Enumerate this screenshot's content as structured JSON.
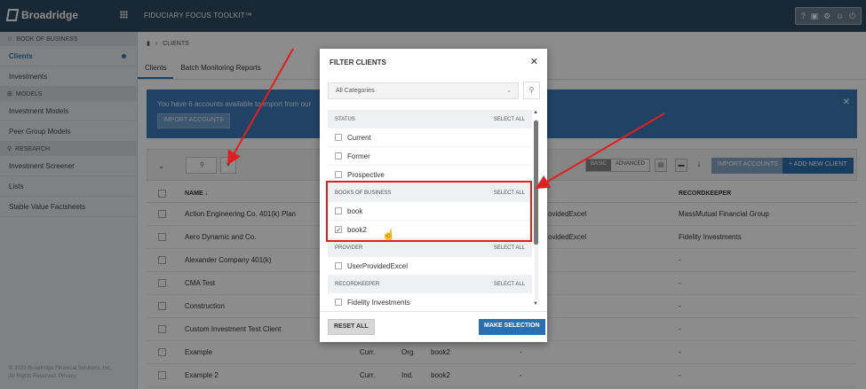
{
  "topbar": {
    "brand": "Broadridge",
    "app_title": "FIDUCIARY FOCUS TOOLKIT™",
    "icons": [
      "help-icon",
      "briefcase-icon",
      "gear-icon",
      "user-icon",
      "power-icon"
    ]
  },
  "sidebar": {
    "sections": [
      {
        "label": "BOOK OF BUSINESS",
        "items": [
          "Clients",
          "Investments"
        ]
      },
      {
        "label": "MODELS",
        "items": [
          "Investment Models",
          "Peer Group Models"
        ]
      },
      {
        "label": "RESEARCH",
        "items": [
          "Investment Screener",
          "Lists",
          "Stable Value Factsheets"
        ]
      }
    ],
    "copyright_1": "© 2023 Broadridge Financial Solutions, Inc.",
    "copyright_2": "All Rights Reserved. Privacy"
  },
  "breadcrumb": {
    "label": "CLIENTS"
  },
  "tabs": [
    "Clients",
    "Batch Monitoring Reports"
  ],
  "banner": {
    "text": "You have 6 accounts available to import from our",
    "button": "IMPORT ACCOUNTS",
    "close": "✕"
  },
  "toolbar": {
    "mode_basic": "BASIC",
    "mode_advanced": "ADVANCED",
    "import_button": "IMPORT ACCOUNTS",
    "add_button": "+ ADD NEW CLIENT"
  },
  "table": {
    "headers": {
      "name": "NAME ↓",
      "recordkeeper": "RECORDKEEPER"
    },
    "rows": [
      {
        "name": "Action Engineering Co. 401(k) Plan",
        "mid": "ovidedExcel",
        "recordkeeper": "MassMutual Financial Group"
      },
      {
        "name": "Aero Dynamic and Co.",
        "mid": "ovidedExcel",
        "recordkeeper": "Fidelity Investments"
      },
      {
        "name": "Alexander Company 401(k)",
        "mid": "",
        "recordkeeper": "-"
      },
      {
        "name": "CMA Test",
        "mid": "",
        "recordkeeper": "-"
      },
      {
        "name": "Construction",
        "mid": "",
        "recordkeeper": "-"
      },
      {
        "name": "Custom Investment Test Client",
        "mid": "",
        "recordkeeper": "-"
      },
      {
        "name": "Example",
        "status": "Curr.",
        "type": "Org.",
        "book": "book2",
        "dash": "-",
        "recordkeeper": "-"
      },
      {
        "name": "Example 2",
        "status": "Curr.",
        "type": "Ind.",
        "book": "book2",
        "dash": "-",
        "recordkeeper": "-"
      }
    ]
  },
  "modal": {
    "title": "FILTER CLIENTS",
    "close": "✕",
    "category_select": "All Categories",
    "select_all": "SELECT ALL",
    "groups": [
      {
        "label": "STATUS",
        "options": [
          {
            "label": "Current",
            "checked": false
          },
          {
            "label": "Former",
            "checked": false
          },
          {
            "label": "Prospective",
            "checked": false
          }
        ]
      },
      {
        "label": "BOOKS OF BUSINESS",
        "options": [
          {
            "label": "book",
            "checked": false
          },
          {
            "label": "book2",
            "checked": true
          }
        ]
      },
      {
        "label": "PROVIDER",
        "options": [
          {
            "label": "UserProvidedExcel",
            "checked": false
          }
        ]
      },
      {
        "label": "RECORDKEEPER",
        "options": [
          {
            "label": "Fidelity Investments",
            "checked": false
          }
        ]
      }
    ],
    "reset_button": "RESET ALL",
    "make_button": "MAKE SELECTION"
  },
  "colors": {
    "topbar": "#2e4a61",
    "accent": "#2a6fb0",
    "highlight": "#e02020"
  }
}
